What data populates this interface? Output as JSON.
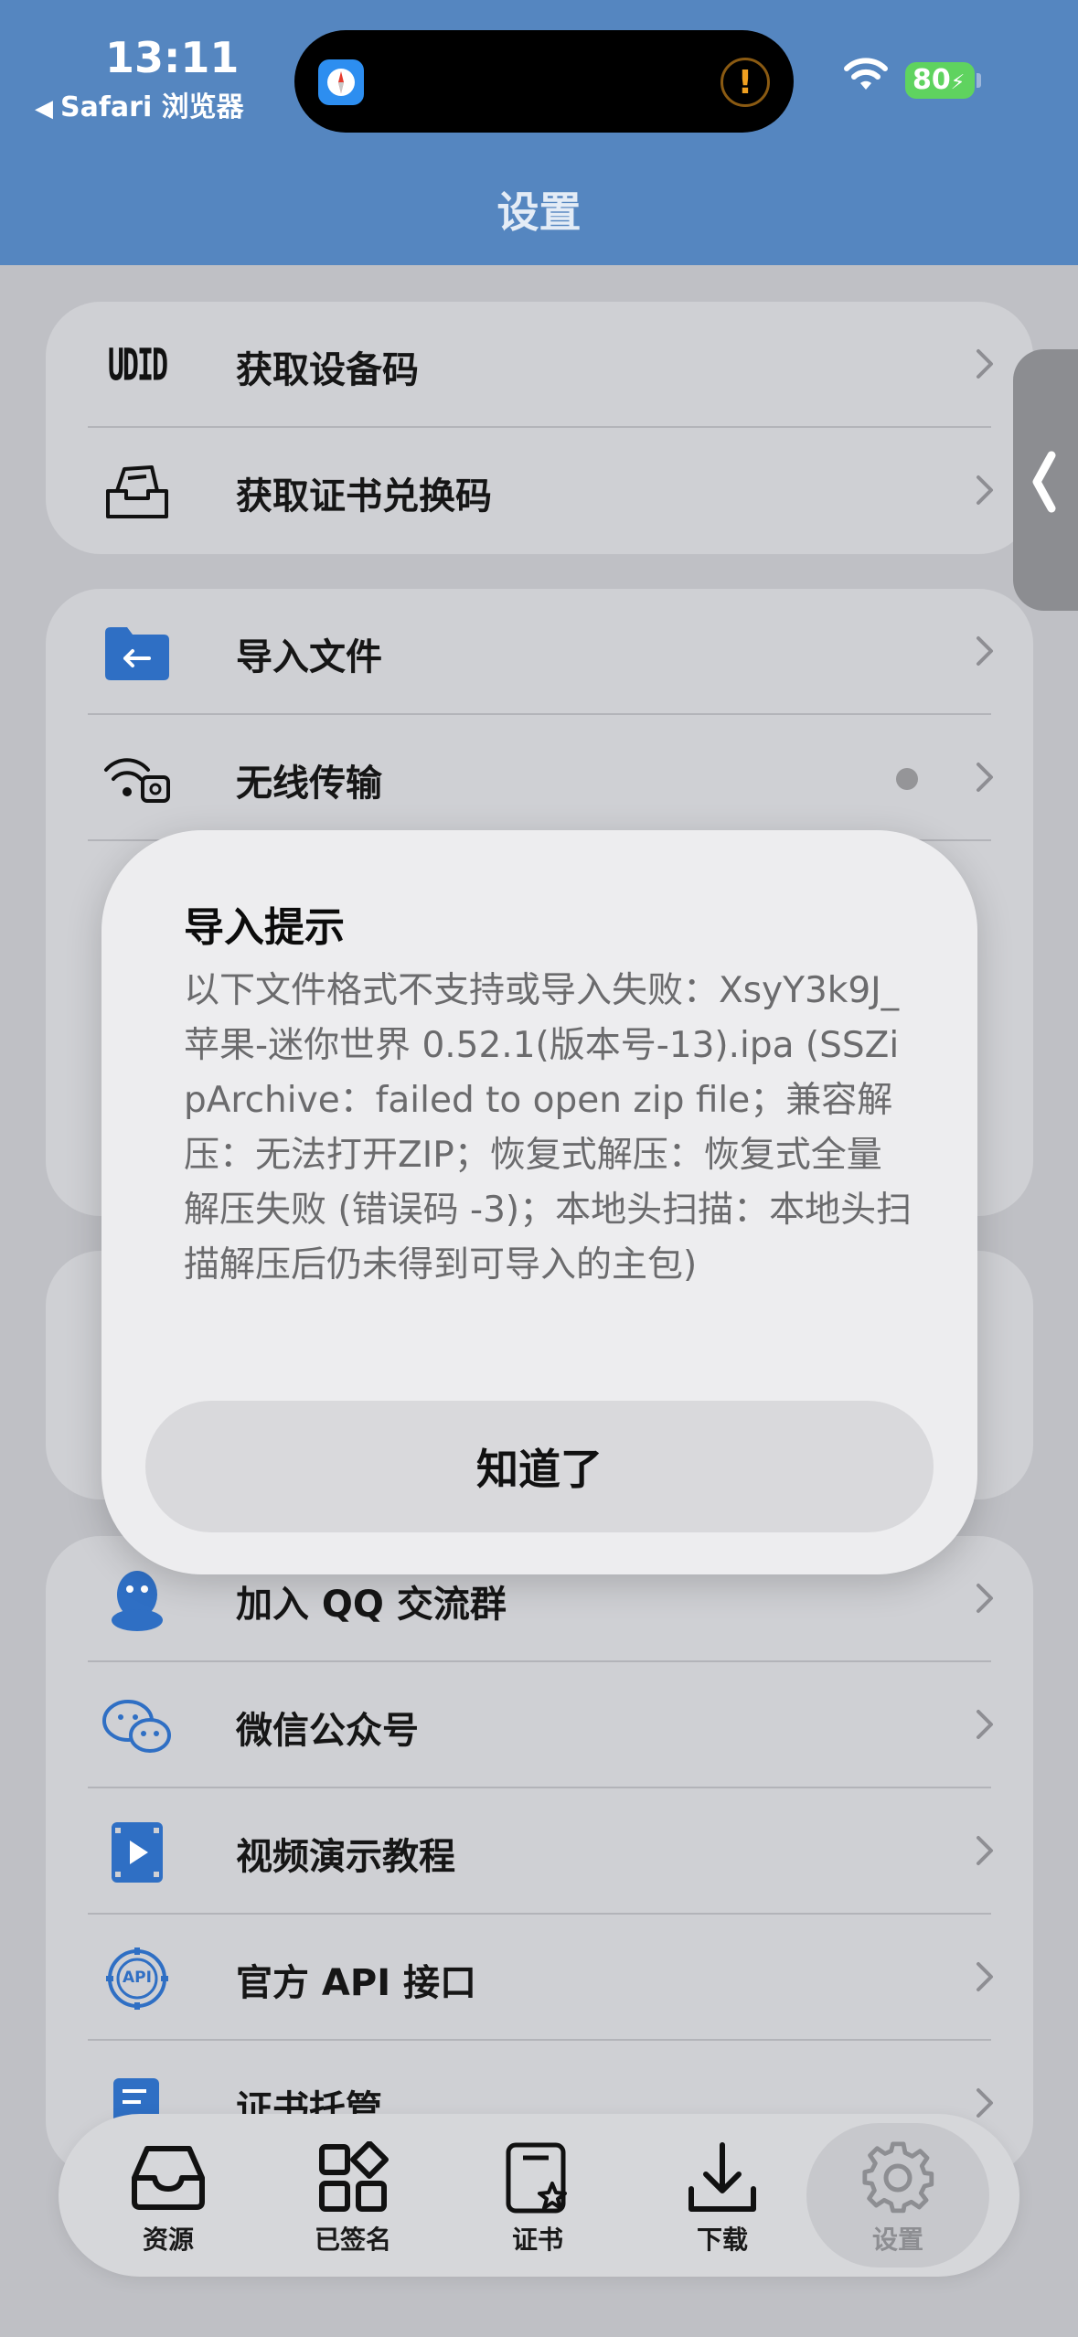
{
  "status_bar": {
    "time": "13:11",
    "back_label": "Safari 浏览器",
    "battery": "80"
  },
  "header": {
    "title": "设置"
  },
  "groups": [
    {
      "items": [
        {
          "label": "获取设备码",
          "icon": "udid-icon",
          "icon_text": "UDID"
        },
        {
          "label": "获取证书兑换码",
          "icon": "tray-icon"
        }
      ]
    },
    {
      "items": [
        {
          "label": "导入文件",
          "icon": "folder-import-icon"
        },
        {
          "label": "无线传输",
          "icon": "wireless-transfer-icon"
        }
      ]
    },
    {
      "items": [
        {
          "label": "加入 QQ 交流群",
          "icon": "qq-icon"
        },
        {
          "label": "微信公众号",
          "icon": "wechat-icon"
        },
        {
          "label": "视频演示教程",
          "icon": "video-icon"
        },
        {
          "label": "官方 API 接口",
          "icon": "api-icon",
          "icon_text": "API"
        },
        {
          "label": "证书托管",
          "icon": "document-icon"
        }
      ]
    }
  ],
  "dialog": {
    "title": "导入提示",
    "message": "以下文件格式不支持或导入失败：XsyY3k9J_苹果-迷你世界 0.52.1(版本号-13).ipa (SSZipArchive：failed to open zip file；兼容解压：无法打开ZIP；恢复式解压：恢复式全量解压失败 (错误码 -3)；本地头扫描：本地头扫描解压后仍未得到可导入的主包)",
    "button": "知道了"
  },
  "tabbar": {
    "tabs": [
      {
        "label": "资源",
        "icon": "inbox-icon"
      },
      {
        "label": "已签名",
        "icon": "apps-icon"
      },
      {
        "label": "证书",
        "icon": "certificate-icon"
      },
      {
        "label": "下载",
        "icon": "download-icon"
      },
      {
        "label": "设置",
        "icon": "gear-icon",
        "active": true
      }
    ]
  },
  "colors": {
    "header": "#5586c0",
    "accent_blue": "#2f6fc4",
    "background": "#bfc0c5"
  }
}
